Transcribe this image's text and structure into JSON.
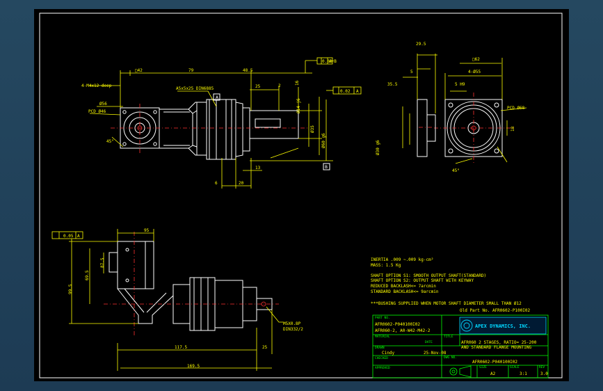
{
  "dimensions": {
    "d42": "□42",
    "d79": "79",
    "d48_5": "48.5",
    "d25": "25",
    "d2": "2",
    "d4m4": "4-M4x12 deep",
    "d56": "Ø56",
    "pcd46": "PCD Ø46",
    "d45a": "45°",
    "key": "A5x5x25 DIN6885",
    "tolA": "0.03",
    "tolAref": "A+B",
    "tolB": "0.02",
    "tolBref": "A",
    "d14": "Ø14 j6",
    "d16": "16",
    "d35": "Ø35",
    "d60": "Ø60 g6",
    "d13": "13",
    "d6": "6",
    "d20": "20",
    "d29_5": "29.5",
    "d5": "5",
    "d35_5": "35.5",
    "d5h9": "5 H9",
    "d4_55": "4-Ø55",
    "d62": "□62",
    "pcd68": "PCD Ø68",
    "d18": "18",
    "d30": "Ø30 g6",
    "d45b": "45°",
    "d95": "95",
    "d87_5": "87.5",
    "d69_5": "69.5",
    "d99_5": "99.5",
    "d117_5": "117.5",
    "d25b": "25",
    "d169_5": "169.5",
    "tolC": "0.05",
    "tolCref": "A",
    "hole": "M5X0.8P",
    "hole2": "DIN332/2",
    "markA": "A",
    "markB": "B"
  },
  "notes": [
    "INERTIA  .009 ~.009  kg-cm²",
    "MASS: 1.5  Kg",
    "SHAFT OPTION S1: SMOOTH OUTPUT SHAFT(STANDARD)",
    "SHAFT OPTION S2: OUTPUT SHAFT WITH KEYWAY",
    "REDUCED BACKLASH<= 7arcmin",
    "STANDARD BACKLASH<= 9arcmin",
    "***BUSHING SUPPLIED WHEN MOTOR SHAFT DIAMETER SMALL THAN Ø12",
    "Old Part No. AFR0602-P100I02"
  ],
  "title_block": {
    "part_no_label": "PART NO.",
    "part_no_1": "AFR0602-P040100I02",
    "part_no_2": "AFR060-2, A0-W42-M42-2",
    "company": "APEX DYNAMICS, INC.",
    "title_label": "TITLE",
    "title_1": "AFR060 2 STAGES, RATIO= 25-200",
    "title_2": "AND STANDARD FLANGE MOUNTING",
    "material_label": "MATERIAL",
    "drawn_label": "DRAWN",
    "drawn_by": "Cindy",
    "date_label": "DATE",
    "date": "25-Nov-08",
    "checked_label": "CHECKED",
    "dwg_label": "DWG NO.",
    "dwg_no": "AFR0602-P040100I02",
    "approved_label": "APPROVED",
    "size_label": "SIZE",
    "size": "A2",
    "scale_label": "SCALE",
    "scale": "3:1",
    "rev_label": "REV",
    "rev": "3.0"
  }
}
